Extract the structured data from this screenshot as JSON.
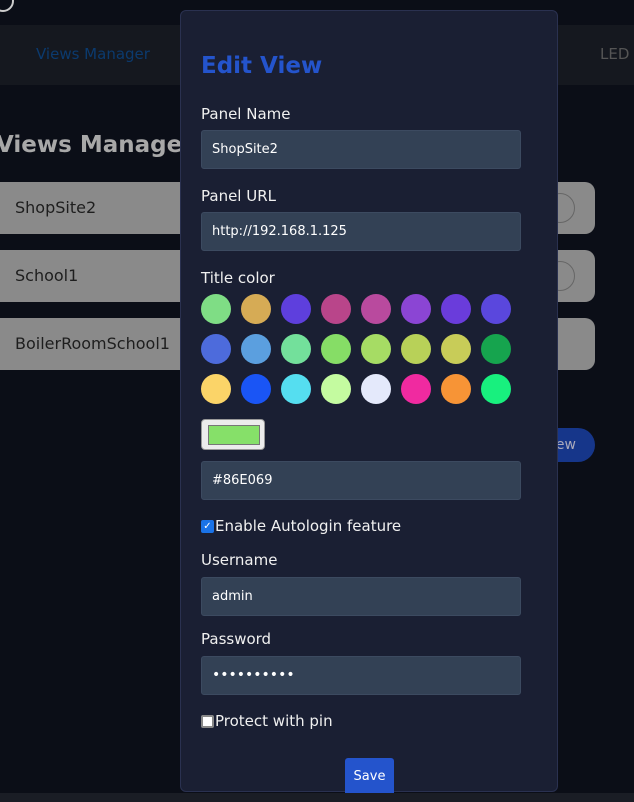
{
  "nav": {
    "items": [
      "Views Manager",
      "LED"
    ],
    "active_color": "#0b3a6e"
  },
  "background": {
    "title": "Views Manager",
    "views": [
      "ShopSite2",
      "School1",
      "BoilerRoomSchool1"
    ],
    "add_button": "iew"
  },
  "modal": {
    "title": "Edit View",
    "panel_name_label": "Panel Name",
    "panel_name": "ShopSite2",
    "panel_url_label": "Panel URL",
    "panel_url": "http://192.168.1.125",
    "title_color_label": "Title color",
    "palette": [
      "#7fdd85",
      "#d6ab55",
      "#5e3fdd",
      "#b9458a",
      "#b94a9e",
      "#8b45d4",
      "#6a3cdb",
      "#5a47dd",
      "#4d6bdc",
      "#5b9fdf",
      "#73e09b",
      "#86dd66",
      "#a6dc64",
      "#b8d158",
      "#c8cc58",
      "#16a44e",
      "#fbd468",
      "#1a55f5",
      "#55def0",
      "#c4fba0",
      "#e4e9fb",
      "#f02aa0",
      "#f79436",
      "#18f07e"
    ],
    "selected_color": "#86E069",
    "autologin_label": "Enable Autologin feature",
    "autologin_checked": true,
    "username_label": "Username",
    "username": "admin",
    "password_label": "Password",
    "password": "••••••••••",
    "pin_label": "Protect with pin",
    "pin_checked": false,
    "save_label": "Save"
  }
}
